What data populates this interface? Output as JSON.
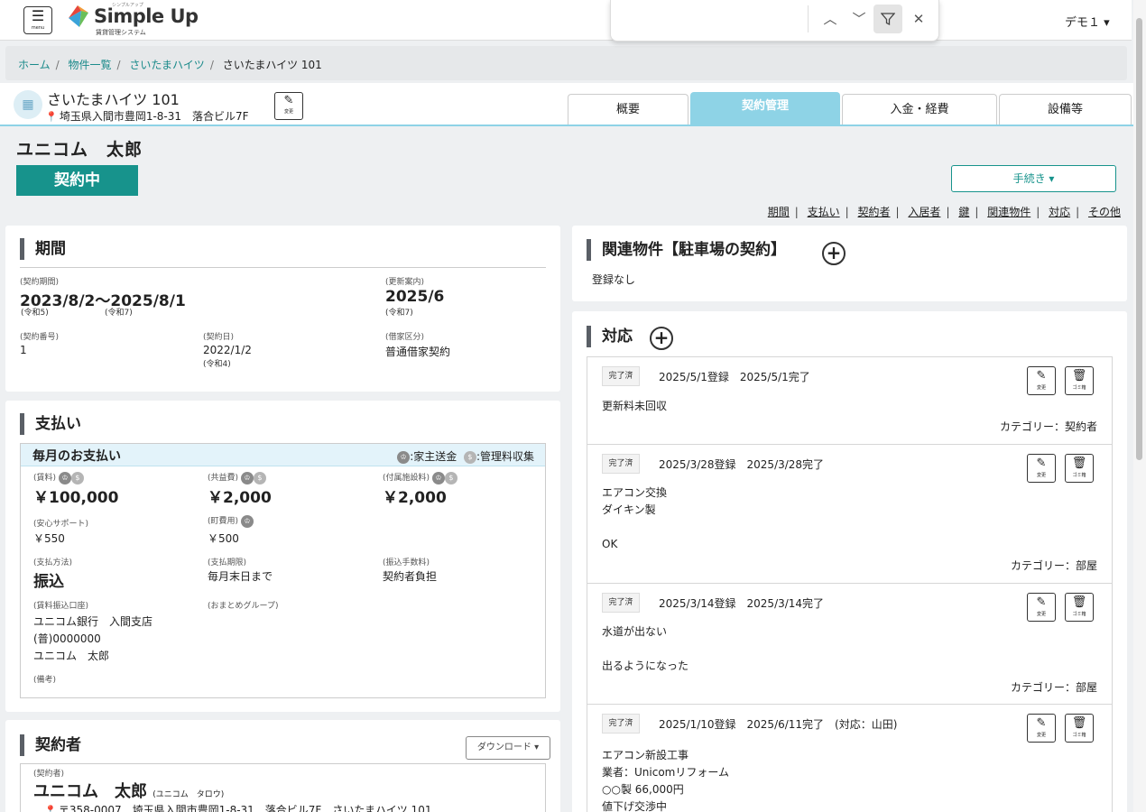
{
  "header": {
    "menu_label": "menu",
    "logo_name": "Simple Up",
    "logo_sub": "賃貸管理システム",
    "logo_ruby": "シンプルアップ",
    "user": "デモ１ ▾",
    "colors": {
      "accent": "#17938c",
      "tab_active": "#8ed3e6"
    }
  },
  "find": {
    "prev": "︿",
    "next": "﹀",
    "filter": "⏚",
    "close": "✕"
  },
  "breadcrumb": {
    "home": "ホーム",
    "list": "物件一覧",
    "building": "さいたまハイツ",
    "current": "さいたまハイツ 101"
  },
  "property": {
    "name": "さいたまハイツ  101",
    "address": "埼玉県入間市豊岡1-8-31　落合ビル7F",
    "edit_label": "変更"
  },
  "tabs": [
    "概要",
    "契約管理",
    "入金・経費",
    "設備等"
  ],
  "tenant": {
    "name": "ユニコム　太郎",
    "status": "契約中",
    "procedure": "手続き ▾"
  },
  "jump_links": [
    "期間",
    "支払い",
    "契約者",
    "入居者",
    "鍵",
    "関連物件",
    "対応",
    "その他"
  ],
  "period": {
    "title": "期間",
    "term_label": "(契約期間)",
    "term": "2023/8/2〜2025/8/1",
    "term_era_start": "(令和5)",
    "term_era_end": "(令和7)",
    "renewal_label": "(更新案内)",
    "renewal": "2025/6",
    "renewal_era": "(令和7)",
    "number_label": "(契約番号)",
    "number": "1",
    "date_label": "(契約日)",
    "date": "2022/1/2",
    "date_era": "(令和4)",
    "lease_label": "(借家区分)",
    "lease": "普通借家契約"
  },
  "payment": {
    "title": "支払い",
    "monthly_title": "毎月のお支払い",
    "legend_owner": ":家主送金",
    "legend_fee": ":管理料収集",
    "rent_label": "(賃料)",
    "rent": "￥100,000",
    "common_label": "(共益費)",
    "common": "￥2,000",
    "facility_label": "(付属施設料)",
    "facility": "￥2,000",
    "support_label": "(安心サポート)",
    "support": "￥550",
    "town_label": "(町費用)",
    "town": "￥500",
    "method_label": "(支払方法)",
    "method": "振込",
    "deadline_label": "(支払期限)",
    "deadline": "毎月末日まで",
    "transfer_fee_label": "(振込手数料)",
    "transfer_fee": "契約者負担",
    "account_label": "(賃料振込口座)",
    "account_bank": "ユニコム銀行　入間支店",
    "account_no": "(普)0000000",
    "account_name": "ユニコム　太郎",
    "group_label": "(おまとめグループ)",
    "note_label": "(備考)"
  },
  "contractor": {
    "title": "契約者",
    "download": "ダウンロード ▾",
    "label": "(契約者)",
    "name": "ユニコム　太郎",
    "kana": "(ユニコム　タロウ)",
    "address": "〒358-0007　埼玉県入間市豊岡1-8-31　落合ビル7F　さいたまハイツ 101"
  },
  "related": {
    "title": "関連物件【駐車場の契約】",
    "empty": "登録なし"
  },
  "responses": {
    "title": "対応",
    "done_label": "完了済",
    "edit_label": "変更",
    "delete_label": "ゴミ箱",
    "items": [
      {
        "date": "2025/5/1登録　2025/5/1完了",
        "body": "更新料未回収",
        "category": "カテゴリー：契約者"
      },
      {
        "date": "2025/3/28登録　2025/3/28完了",
        "body": "エアコン交換\nダイキン製\n\nOK",
        "category": "カテゴリー：部屋"
      },
      {
        "date": "2025/3/14登録　2025/3/14完了",
        "body": "水道が出ない\n\n出るようになった",
        "category": "カテゴリー：部屋"
      },
      {
        "date": "2025/1/10登録　2025/6/11完了　(対応：山田)",
        "body": "エアコン新設工事\n業者：Unicomリフォーム\n○○製 66,000円\n値下げ交渉中",
        "category": ""
      }
    ]
  }
}
